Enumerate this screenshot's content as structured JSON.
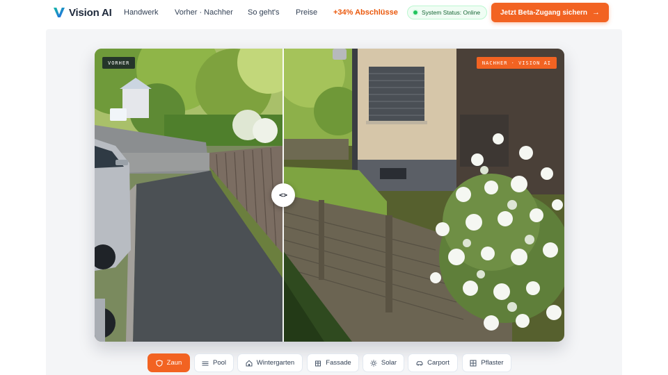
{
  "brand": {
    "name": "Vision AI"
  },
  "nav": {
    "links": [
      {
        "label": "Handwerk"
      },
      {
        "label": "Vorher · Nachher"
      },
      {
        "label": "So geht's"
      },
      {
        "label": "Preise"
      },
      {
        "label": "+34% Abschlüsse"
      }
    ],
    "status": "System Status: Online",
    "cta": "Jetzt Beta-Zugang sichern"
  },
  "compare": {
    "before_label": "VORHER",
    "after_label": "NACHHER · VISION AI",
    "handle_glyph": "<>"
  },
  "categories": [
    {
      "label": "Zaun",
      "icon": "shield-icon",
      "active": true
    },
    {
      "label": "Pool",
      "icon": "waves-icon",
      "active": false
    },
    {
      "label": "Wintergarten",
      "icon": "house-icon",
      "active": false
    },
    {
      "label": "Fassade",
      "icon": "building-icon",
      "active": false
    },
    {
      "label": "Solar",
      "icon": "sun-icon",
      "active": false
    },
    {
      "label": "Carport",
      "icon": "car-icon",
      "active": false
    },
    {
      "label": "Pflaster",
      "icon": "grid-icon",
      "active": false
    }
  ],
  "colors": {
    "accent": "#f26322",
    "status_green": "#22c55e",
    "brand_gradient_start": "#0ea5a4",
    "brand_gradient_end": "#2563eb"
  }
}
